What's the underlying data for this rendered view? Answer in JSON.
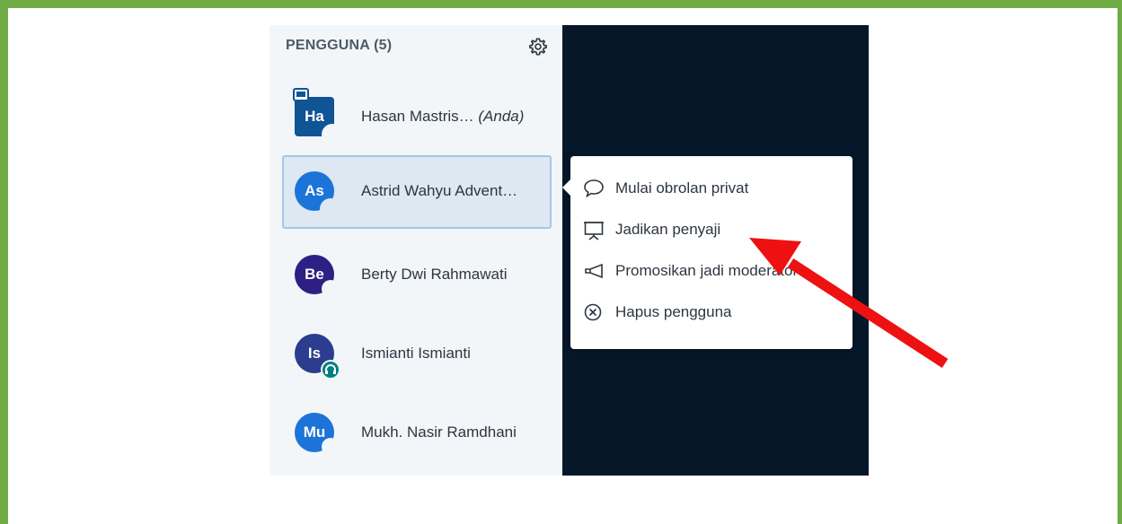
{
  "panel": {
    "header": "PENGGUNA (5)"
  },
  "users": [
    {
      "initials": "Ha",
      "name": "Hasan Mastris…",
      "suffix": "(Anda)",
      "color": "#0f5494"
    },
    {
      "initials": "As",
      "name": "Astrid Wahyu Advent…",
      "color": "#1c74d8"
    },
    {
      "initials": "Be",
      "name": "Berty Dwi Rahmawati",
      "color": "#2e1f84"
    },
    {
      "initials": "Is",
      "name": "Ismianti Ismianti",
      "color": "#2c3d8f"
    },
    {
      "initials": "Mu",
      "name": "Mukh. Nasir Ramdhani",
      "color": "#1c74d8"
    }
  ],
  "menu": {
    "items": [
      {
        "label": "Mulai obrolan privat",
        "icon": "chat-bubble-icon"
      },
      {
        "label": "Jadikan penyaji",
        "icon": "presentation-icon"
      },
      {
        "label": "Promosikan jadi moderator",
        "icon": "megaphone-icon"
      },
      {
        "label": "Hapus pengguna",
        "icon": "remove-circle-icon"
      }
    ]
  },
  "colors": {
    "frame": "#6faa45",
    "panel_bg": "#f3f6f9",
    "dark_bg": "#06172a",
    "arrow": "#ee1111",
    "listen_badge": "#008081"
  }
}
